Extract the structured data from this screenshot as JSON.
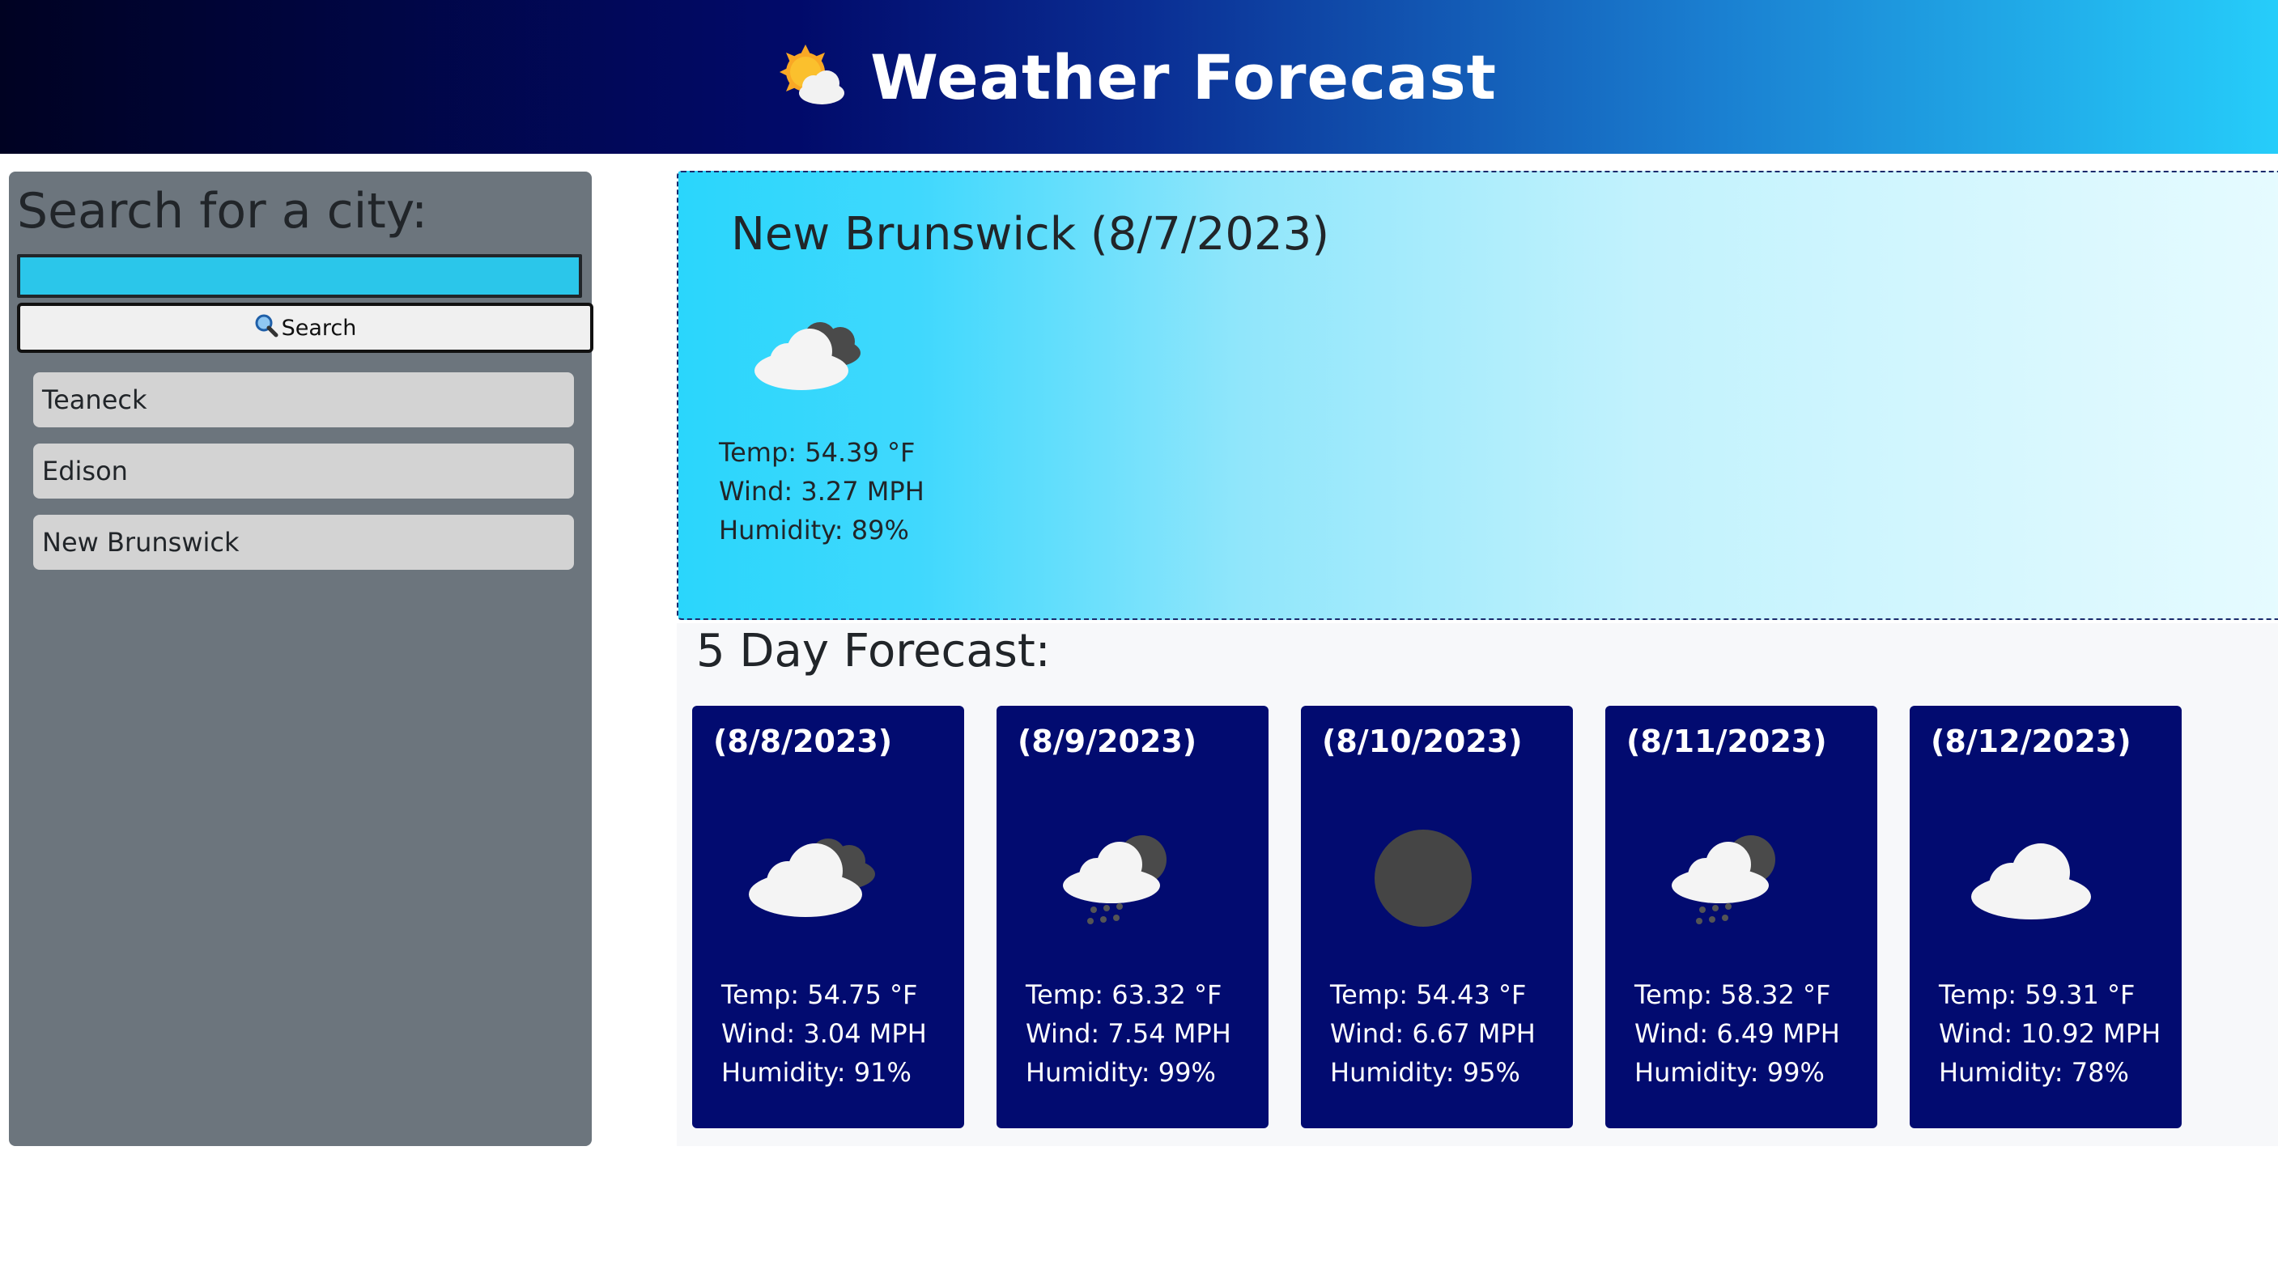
{
  "header": {
    "title": "Weather Forecast",
    "icon": "sun-behind-cloud-icon"
  },
  "sidebar": {
    "heading": "Search for a city:",
    "search_input_value": "",
    "search_button_label": "Search",
    "history": [
      "Teaneck",
      "Edison",
      "New Brunswick"
    ]
  },
  "current": {
    "title": "New Brunswick (8/7/2023)",
    "icon": "broken-clouds-icon",
    "temp": "Temp: 54.39 °F",
    "wind": "Wind: 3.27 MPH",
    "humidity": "Humidity: 89%"
  },
  "forecast": {
    "heading": "5 Day Forecast:",
    "days": [
      {
        "date": "(8/8/2023)",
        "icon": "broken-clouds-icon",
        "temp": "Temp: 54.75 °F",
        "wind": "Wind: 3.04 MPH",
        "humidity": "Humidity: 91%"
      },
      {
        "date": "(8/9/2023)",
        "icon": "rain-icon",
        "temp": "Temp: 63.32 °F",
        "wind": "Wind: 7.54 MPH",
        "humidity": "Humidity: 99%"
      },
      {
        "date": "(8/10/2023)",
        "icon": "overcast-icon",
        "temp": "Temp: 54.43 °F",
        "wind": "Wind: 6.67 MPH",
        "humidity": "Humidity: 95%"
      },
      {
        "date": "(8/11/2023)",
        "icon": "rain-icon",
        "temp": "Temp: 58.32 °F",
        "wind": "Wind: 6.49 MPH",
        "humidity": "Humidity: 99%"
      },
      {
        "date": "(8/12/2023)",
        "icon": "cloud-icon",
        "temp": "Temp: 59.31 °F",
        "wind": "Wind: 10.92 MPH",
        "humidity": "Humidity: 78%"
      }
    ]
  },
  "colors": {
    "header_gradient": [
      "#000222",
      "#010a6a",
      "#26cdfa"
    ],
    "sidebar_bg": "#6c757d",
    "search_input_bg": "#2bc6ea",
    "card_bg": "#020b70",
    "current_gradient": [
      "#2ad6fc",
      "#e6fbff"
    ]
  }
}
